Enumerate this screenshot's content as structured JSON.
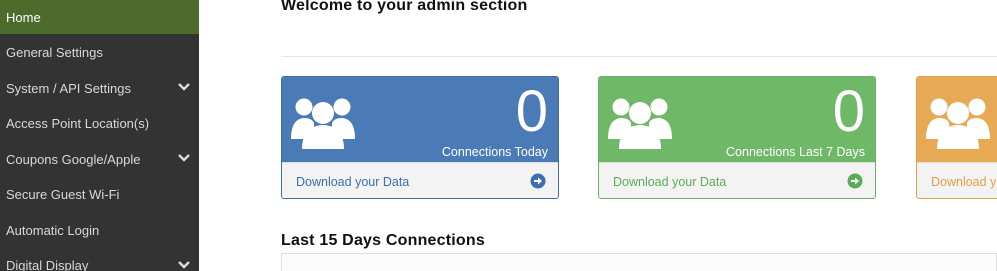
{
  "sidebar": {
    "items": [
      {
        "label": "Home",
        "active": true,
        "has_submenu": false
      },
      {
        "label": "General Settings",
        "active": false,
        "has_submenu": false
      },
      {
        "label": "System / API Settings",
        "active": false,
        "has_submenu": true
      },
      {
        "label": "Access Point Location(s)",
        "active": false,
        "has_submenu": false
      },
      {
        "label": "Coupons Google/Apple",
        "active": false,
        "has_submenu": true
      },
      {
        "label": "Secure Guest Wi-Fi",
        "active": false,
        "has_submenu": false
      },
      {
        "label": "Automatic Login",
        "active": false,
        "has_submenu": false
      },
      {
        "label": "Digital Display",
        "active": false,
        "has_submenu": true
      }
    ]
  },
  "main": {
    "welcome": "Welcome to your admin section",
    "panels": [
      {
        "count": "0",
        "caption": "Connections Today",
        "link": "Download your Data",
        "color": "#4a7bb7",
        "icon": "users-icon"
      },
      {
        "count": "0",
        "caption": "Connections Last 7 Days",
        "link": "Download your Data",
        "color": "#6fb868",
        "icon": "users-icon"
      },
      {
        "count": "",
        "caption": "",
        "link": "Download y",
        "color": "#e8a955",
        "icon": "users-icon"
      }
    ],
    "section_title": "Last 15 Days Connections"
  }
}
